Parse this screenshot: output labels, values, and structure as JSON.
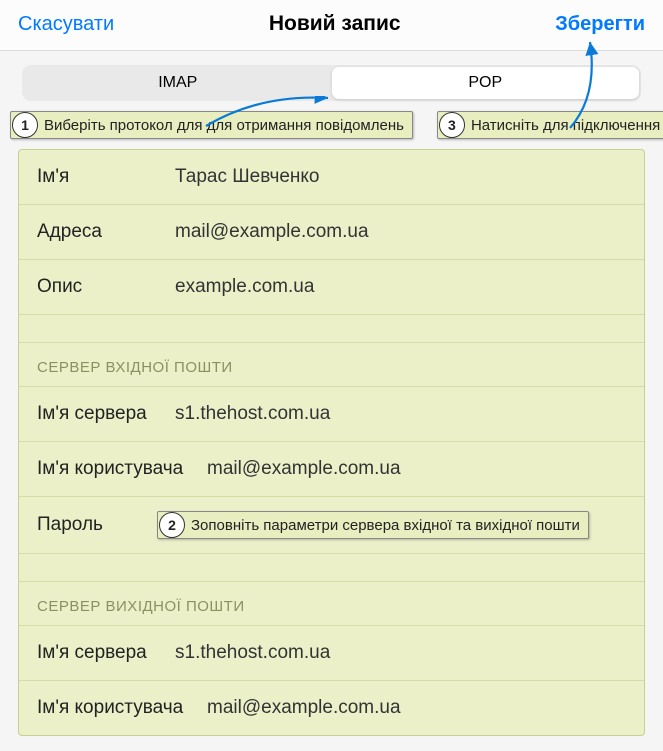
{
  "header": {
    "cancel": "Скасувати",
    "title": "Новий запис",
    "save": "Зберегти"
  },
  "segmented": {
    "imap": "IMAP",
    "pop": "POP"
  },
  "callouts": {
    "c1": "Виберіть протокол для для отримання повідомлень",
    "c2": "Зоповніть параметри сервера вхідної та вихідної пошти",
    "c3": "Натисніть для підключення"
  },
  "account": {
    "name_label": "Ім'я",
    "name_value": "Тарас Шевченко",
    "address_label": "Адреса",
    "address_value": "mail@example.com.ua",
    "desc_label": "Опис",
    "desc_value": "example.com.ua"
  },
  "incoming": {
    "section": "СЕРВЕР ВХІДНОЇ ПОШТИ",
    "host_label": "Ім'я сервера",
    "host_value": "s1.thehost.com.ua",
    "user_label": "Ім'я користувача",
    "user_value": "mail@example.com.ua",
    "pass_label": "Пароль"
  },
  "outgoing": {
    "section": "СЕРВЕР ВИХІДНОЇ ПОШТИ",
    "host_label": "Ім'я сервера",
    "host_value": "s1.thehost.com.ua",
    "user_label": "Ім'я користувача",
    "user_value": "mail@example.com.ua"
  }
}
